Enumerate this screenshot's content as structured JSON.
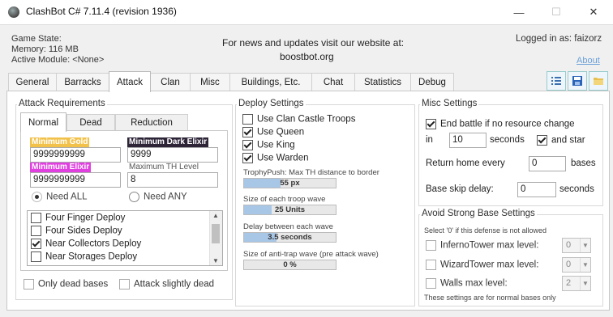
{
  "window": {
    "title": "ClashBot C# 7.11.4 (revision 1936)",
    "minimize": "—",
    "maximize": "☐",
    "close": "✕"
  },
  "header": {
    "game_state": "Game State:",
    "memory": "Memory: 116 MB",
    "active_module": "Active Module: <None>",
    "news": "For news and updates visit our website at:",
    "website": "boostbot.org",
    "logged_in": "Logged in as: faizorz",
    "about": "About"
  },
  "tabs": [
    "General",
    "Barracks",
    "Attack",
    "Clan",
    "Misc",
    "Buildings, Etc.",
    "Chat",
    "Statistics",
    "Debug"
  ],
  "active_tab": "Attack",
  "attack_requirements": {
    "title": "Attack Requirements",
    "subtabs": [
      "Normal",
      "Dead",
      "Reduction"
    ],
    "min_gold_label": "Minimum Gold",
    "min_gold": "9999999999",
    "min_dark_label": "Minimum Dark Elixir",
    "min_dark": "9999",
    "min_elixir_label": "Minimum Elixir",
    "min_elixir": "9999999999",
    "max_th_label": "Maximum TH Level",
    "max_th": "8",
    "need_all": "Need ALL",
    "need_any": "Need ANY",
    "deploy_list": [
      {
        "label": "Four Finger Deploy",
        "checked": false
      },
      {
        "label": "Four Sides Deploy",
        "checked": false
      },
      {
        "label": "Near Collectors Deploy",
        "checked": true
      },
      {
        "label": "Near Storages Deploy",
        "checked": false
      }
    ],
    "only_dead": "Only dead bases",
    "attack_slightly_dead": "Attack slightly dead",
    "colors": {
      "gold": "#f2c14a",
      "dark": "#2d2438",
      "elixir": "#e040e0"
    }
  },
  "deploy_settings": {
    "title": "Deploy Settings",
    "checks": [
      {
        "label": "Use Clan Castle Troops",
        "checked": false
      },
      {
        "label": "Use Queen",
        "checked": true
      },
      {
        "label": "Use King",
        "checked": true
      },
      {
        "label": "Use Warden",
        "checked": true
      }
    ],
    "sliders": [
      {
        "label": "TrophyPush: Max TH distance to border",
        "text": "55 px",
        "fill": 0.4
      },
      {
        "label": "Size of each troop wave",
        "text": "25 Units",
        "fill": 0.3
      },
      {
        "label": "Delay between each wave",
        "text": "3.5 seconds",
        "fill": 0.35
      },
      {
        "label": "Size of anti-trap wave (pre attack wave)",
        "text": "0 %",
        "fill": 0
      }
    ]
  },
  "misc_settings": {
    "title": "Misc Settings",
    "end_battle": "End battle if no resource change",
    "in_label": "in",
    "seconds_value": "10",
    "seconds_label": "seconds",
    "and_star": "and star",
    "return_home": "Return home every",
    "return_value": "0",
    "bases_label": "bases",
    "skip_delay": "Base skip delay:",
    "skip_value": "0",
    "skip_seconds": "seconds"
  },
  "avoid_settings": {
    "title": "Avoid Strong Base Settings",
    "hint": "Select '0' if this defense is not allowed",
    "items": [
      {
        "label": "InfernoTower max level:",
        "value": "0"
      },
      {
        "label": "WizardTower max level:",
        "value": "0"
      },
      {
        "label": "Walls max level:",
        "value": "2"
      }
    ],
    "footer": "These settings are for normal bases only"
  }
}
